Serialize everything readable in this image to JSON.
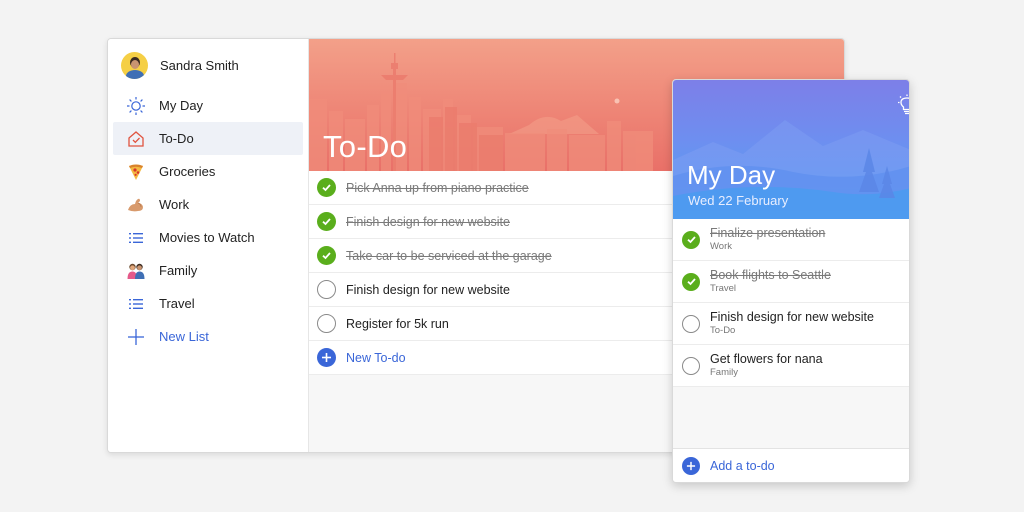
{
  "user": {
    "name": "Sandra Smith"
  },
  "sidebar": {
    "items": [
      {
        "label": "My Day",
        "icon": "sun-icon"
      },
      {
        "label": "To-Do",
        "icon": "home-icon",
        "active": true
      },
      {
        "label": "Groceries",
        "icon": "pizza-icon"
      },
      {
        "label": "Work",
        "icon": "flexed-arm-icon"
      },
      {
        "label": "Movies to Watch",
        "icon": "list-icon"
      },
      {
        "label": "Family",
        "icon": "family-icon"
      },
      {
        "label": "Travel",
        "icon": "list-icon"
      }
    ],
    "new_list_label": "New List"
  },
  "main": {
    "title": "To-Do",
    "tasks": [
      {
        "text": "Pick Anna up from piano practice",
        "completed": true
      },
      {
        "text": "Finish design for new website",
        "completed": true
      },
      {
        "text": "Take car to be serviced at the garage",
        "completed": true
      },
      {
        "text": "Finish design for new website",
        "completed": false
      },
      {
        "text": "Register for 5k run",
        "completed": false
      }
    ],
    "new_todo_label": "New To-do"
  },
  "myday": {
    "title": "My Day",
    "date": "Wed 22 February",
    "tasks": [
      {
        "text": "Finalize presentation",
        "list": "Work",
        "completed": true
      },
      {
        "text": "Book flights to Seattle",
        "list": "Travel",
        "completed": true
      },
      {
        "text": "Finish design for new website",
        "list": "To-Do",
        "completed": false
      },
      {
        "text": "Get flowers for nana",
        "list": "Family",
        "completed": false
      }
    ],
    "add_label": "Add a to-do"
  },
  "colors": {
    "accent": "#3a66d8",
    "done": "#5aae1c",
    "todo_hero": "#ee8576",
    "myday_hero": "#6d8ff0"
  }
}
